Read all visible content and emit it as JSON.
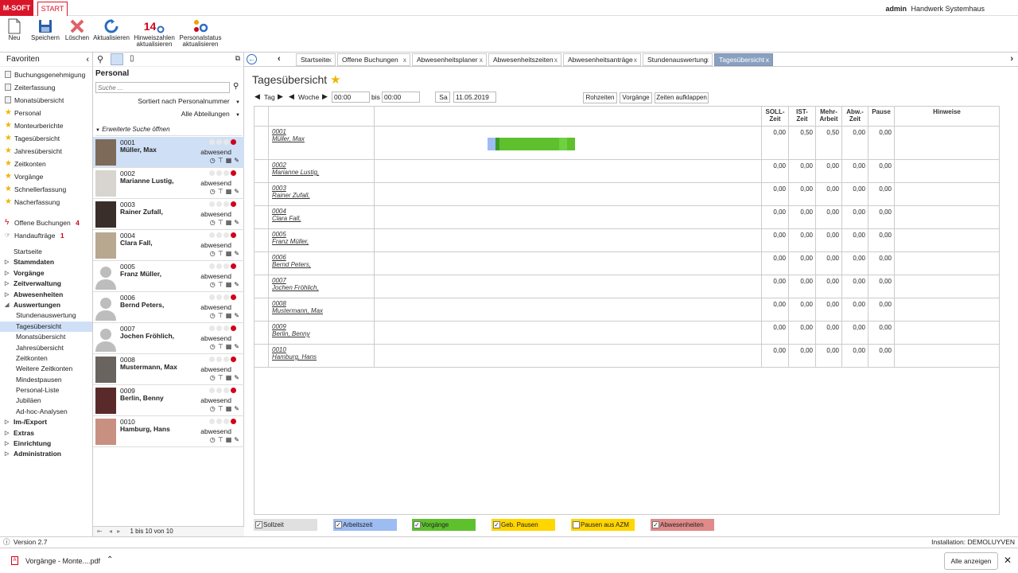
{
  "app": {
    "logo": "M-SOFT",
    "start_tab": "START",
    "user": "admin",
    "company": "Handwerk Systemhaus"
  },
  "ribbon": [
    {
      "label": "Neu",
      "icon": "new-document-icon"
    },
    {
      "label": "Speichern",
      "icon": "save-icon"
    },
    {
      "label": "Löschen",
      "icon": "delete-icon"
    },
    {
      "label": "Aktualisieren",
      "icon": "refresh-icon"
    },
    {
      "label": "Hinweiszahlen aktualisieren",
      "badge": "14",
      "icon": "notification-refresh-icon"
    },
    {
      "label": "Personalstatus aktualisieren",
      "icon": "status-refresh-icon"
    }
  ],
  "favorites": {
    "title": "Favoriten",
    "items": [
      "Buchungsgenehmigung",
      "Zeiterfassung",
      "Monatsübersicht",
      "Personal",
      "Monteurberichte",
      "Tagesübersicht",
      "Jahresübersicht",
      "Zeitkonten",
      "Vorgänge",
      "Schnellerfassung",
      "Nacherfassung"
    ]
  },
  "alerts": [
    {
      "label": "Offene Buchungen",
      "count": "4"
    },
    {
      "label": "Handaufträge",
      "count": "1"
    }
  ],
  "nav": [
    {
      "label": "Startseite",
      "level": 0,
      "bold": false,
      "arrow": ""
    },
    {
      "label": "Stammdaten",
      "level": 0,
      "bold": true,
      "arrow": "▷"
    },
    {
      "label": "Vorgänge",
      "level": 0,
      "bold": true,
      "arrow": "▷"
    },
    {
      "label": "Zeitverwaltung",
      "level": 0,
      "bold": true,
      "arrow": "▷"
    },
    {
      "label": "Abwesenheiten",
      "level": 0,
      "bold": true,
      "arrow": "▷"
    },
    {
      "label": "Auswertungen",
      "level": 0,
      "bold": true,
      "arrow": "◢"
    },
    {
      "label": "Stundenauswertung",
      "level": 1,
      "bold": false,
      "arrow": ""
    },
    {
      "label": "Tagesübersicht",
      "level": 1,
      "bold": false,
      "arrow": "",
      "selected": true
    },
    {
      "label": "Monatsübersicht",
      "level": 1,
      "bold": false,
      "arrow": ""
    },
    {
      "label": "Jahresübersicht",
      "level": 1,
      "bold": false,
      "arrow": ""
    },
    {
      "label": "Zeitkonten",
      "level": 1,
      "bold": false,
      "arrow": ""
    },
    {
      "label": "Weitere Zeitkonten",
      "level": 1,
      "bold": false,
      "arrow": ""
    },
    {
      "label": "Mindestpausen",
      "level": 1,
      "bold": false,
      "arrow": ""
    },
    {
      "label": "Personal-Liste",
      "level": 1,
      "bold": false,
      "arrow": ""
    },
    {
      "label": "Jubiläen",
      "level": 1,
      "bold": false,
      "arrow": ""
    },
    {
      "label": "Ad-hoc-Analysen",
      "level": 1,
      "bold": false,
      "arrow": ""
    },
    {
      "label": "Im-/Export",
      "level": 0,
      "bold": true,
      "arrow": "▷"
    },
    {
      "label": "Extras",
      "level": 0,
      "bold": true,
      "arrow": "▷"
    },
    {
      "label": "Einrichtung",
      "level": 0,
      "bold": true,
      "arrow": "▷"
    },
    {
      "label": "Administration",
      "level": 0,
      "bold": true,
      "arrow": "▷"
    }
  ],
  "personal": {
    "title": "Personal",
    "search_placeholder": "Suche ...",
    "sort": "Sortiert nach Personalnummer",
    "department": "Alle Abteilungen",
    "extended_search": "Erweiterte Suche öffnen",
    "status_label": "abwesend",
    "pager": "1 bis 10 von 10",
    "employees": [
      {
        "nr": "0001",
        "name": "Müller, Max",
        "photo": true
      },
      {
        "nr": "0002",
        "name": "Marianne Lustig,",
        "photo": true
      },
      {
        "nr": "0003",
        "name": "Rainer Zufall,",
        "photo": true
      },
      {
        "nr": "0004",
        "name": "Clara Fall,",
        "photo": true
      },
      {
        "nr": "0005",
        "name": "Franz Müller,",
        "photo": false
      },
      {
        "nr": "0006",
        "name": "Bernd Peters,",
        "photo": false
      },
      {
        "nr": "0007",
        "name": "Jochen Fröhlich,",
        "photo": false
      },
      {
        "nr": "0008",
        "name": "Mustermann, Max",
        "photo": true
      },
      {
        "nr": "0009",
        "name": "Berlin, Benny",
        "photo": true
      },
      {
        "nr": "0010",
        "name": "Hamburg, Hans",
        "photo": true
      }
    ]
  },
  "tabs": [
    "Startseite",
    "Offene Buchungen",
    "Abwesenheitsplaner",
    "Abwesenheitszeiten",
    "Abwesenheitsanträge",
    "Stundenauswertung",
    "Tagesübersicht"
  ],
  "page": {
    "title": "Tagesübersicht",
    "tag_label": "Tag",
    "woche_label": "Woche",
    "time_from": "00:00",
    "bis_label": "bis",
    "time_to": "00:00",
    "weekday": "Sa",
    "date": "11.05.2019",
    "btn_rohzeiten": "Rohzeiten",
    "btn_vorgaenge": "Vorgänge",
    "btn_aufklappen": "Zeiten aufklappen"
  },
  "grid": {
    "columns": [
      {
        "label": "SOLL-\nZeit"
      },
      {
        "label": "IST-\nZeit"
      },
      {
        "label": "Mehr-\nArbeit"
      },
      {
        "label": "Abw.-\nZeit"
      },
      {
        "label": "Pause"
      },
      {
        "label": "Hinweise"
      }
    ],
    "rows": [
      {
        "nr": "0001",
        "name": "Müller, Max",
        "values": [
          "0,00",
          "0,50",
          "0,50",
          "0,00",
          "0,00"
        ]
      },
      {
        "nr": "0002",
        "name": "Marianne Lustig,",
        "values": [
          "0,00",
          "0,00",
          "0,00",
          "0,00",
          "0,00"
        ]
      },
      {
        "nr": "0003",
        "name": "Rainer Zufall,",
        "values": [
          "0,00",
          "0,00",
          "0,00",
          "0,00",
          "0,00"
        ]
      },
      {
        "nr": "0004",
        "name": "Clara Fall,",
        "values": [
          "0,00",
          "0,00",
          "0,00",
          "0,00",
          "0,00"
        ]
      },
      {
        "nr": "0005",
        "name": "Franz Müller,",
        "values": [
          "0,00",
          "0,00",
          "0,00",
          "0,00",
          "0,00"
        ]
      },
      {
        "nr": "0006",
        "name": "Bernd Peters,",
        "values": [
          "0,00",
          "0,00",
          "0,00",
          "0,00",
          "0,00"
        ]
      },
      {
        "nr": "0007",
        "name": "Jochen Fröhlich,",
        "values": [
          "0,00",
          "0,00",
          "0,00",
          "0,00",
          "0,00"
        ]
      },
      {
        "nr": "0008",
        "name": "Mustermann, Max",
        "values": [
          "0,00",
          "0,00",
          "0,00",
          "0,00",
          "0,00"
        ]
      },
      {
        "nr": "0009",
        "name": "Berlin, Benny",
        "values": [
          "0,00",
          "0,00",
          "0,00",
          "0,00",
          "0,00"
        ]
      },
      {
        "nr": "0010",
        "name": "Hamburg, Hans",
        "values": [
          "0,00",
          "0,00",
          "0,00",
          "0,00",
          "0,00"
        ]
      }
    ]
  },
  "legend": [
    {
      "label": "Sollzeit",
      "color": "#e0e0e0",
      "checked": true
    },
    {
      "label": "Arbeitszeit",
      "color": "#9dbcf2",
      "checked": true
    },
    {
      "label": "Vorgänge",
      "color": "#5fc02e",
      "checked": true
    },
    {
      "label": "Geb. Pausen",
      "color": "#ffd600",
      "checked": true
    },
    {
      "label": "Pausen aus AZM",
      "color": "#ffd600",
      "checked": false
    },
    {
      "label": "Abwesenheiten",
      "color": "#e08a8a",
      "checked": true
    }
  ],
  "status": {
    "version": "Version 2.7",
    "installation": "Installation: DEMOLUYVEN"
  },
  "download": {
    "file": "Vorgänge - Monte....pdf",
    "show_all": "Alle anzeigen"
  }
}
